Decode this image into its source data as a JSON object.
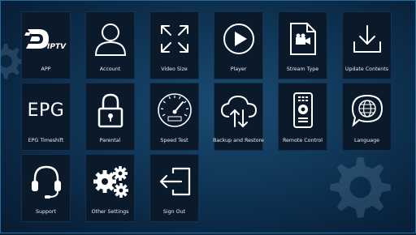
{
  "tiles": [
    {
      "label": "APP",
      "icon": "iptv-logo-icon",
      "logo_text": "IPTV"
    },
    {
      "label": "Account",
      "icon": "user-icon"
    },
    {
      "label": "Video Size",
      "icon": "expand-arrows-icon"
    },
    {
      "label": "Player",
      "icon": "play-icon"
    },
    {
      "label": "Stream Type",
      "icon": "video-file-icon"
    },
    {
      "label": "Update Contents",
      "icon": "download-icon"
    },
    {
      "label": "EPG Timeshift",
      "icon": "epg-text-icon",
      "icon_text": "EPG"
    },
    {
      "label": "Parental",
      "icon": "padlock-icon"
    },
    {
      "label": "Speed Test",
      "icon": "speedometer-icon"
    },
    {
      "label": "Backup and Restore",
      "icon": "cloud-sync-icon"
    },
    {
      "label": "Remote Control",
      "icon": "remote-control-icon"
    },
    {
      "label": "Language",
      "icon": "globe-chat-icon"
    },
    {
      "label": "Support",
      "icon": "headset-icon"
    },
    {
      "label": "Other Settings",
      "icon": "gears-icon"
    },
    {
      "label": "Sign Out",
      "icon": "sign-out-icon"
    }
  ],
  "colors": {
    "background": "#0f3556",
    "tile": "#0a1a2b",
    "icon": "#ffffff"
  }
}
